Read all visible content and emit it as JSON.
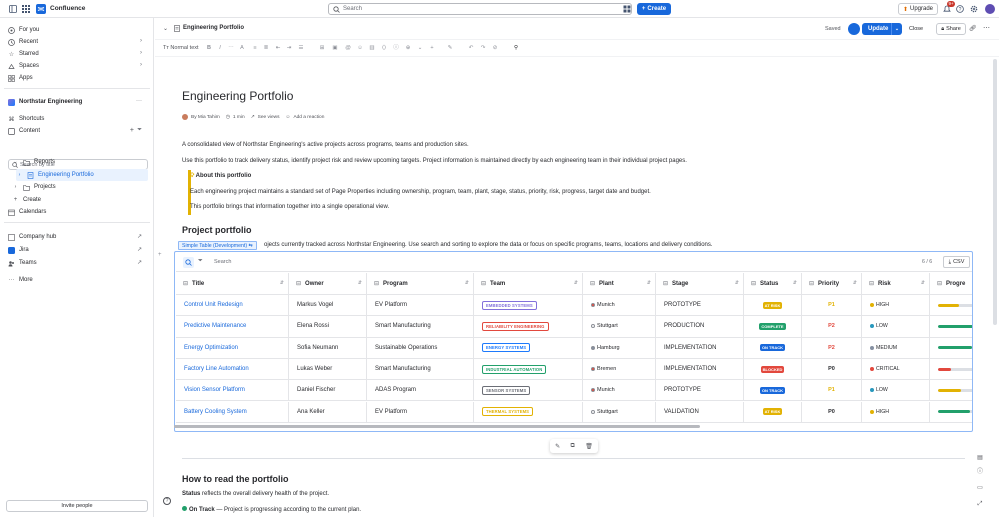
{
  "topbar": {
    "app_name": "Confluence",
    "search_placeholder": "Search",
    "create_label": "Create",
    "upgrade_label": "Upgrade",
    "notifications_count": "9+"
  },
  "sidebar": {
    "items_top": [
      {
        "label": "For you"
      },
      {
        "label": "Recent"
      },
      {
        "label": "Starred"
      },
      {
        "label": "Spaces"
      },
      {
        "label": "Apps"
      }
    ],
    "space_name": "Northstar Engineering",
    "shortcuts_label": "Shortcuts",
    "content_label": "Content",
    "search_placeholder": "Search by title",
    "tree": [
      {
        "label": "Reports"
      },
      {
        "label": "Engineering Portfolio"
      },
      {
        "label": "Projects"
      },
      {
        "label": "Create"
      }
    ],
    "calendars_label": "Calendars",
    "apps": [
      {
        "label": "Company hub"
      },
      {
        "label": "Jira"
      },
      {
        "label": "Teams"
      }
    ],
    "more_label": "More",
    "invite_label": "Invite people"
  },
  "page_header": {
    "title": "Engineering Portfolio",
    "saved_label": "Saved",
    "update_label": "Update",
    "close_label": "Close",
    "share_label": "Share"
  },
  "toolbar": {
    "text_style": "Normal text"
  },
  "doc": {
    "title": "Engineering Portfolio",
    "byline": {
      "author": "By Mia Tahim",
      "read_time": "1 min",
      "views": "See views",
      "reaction": "Add a reaction"
    },
    "intro1": "A consolidated view of Northstar Engineering's active projects across programs, teams and production sites.",
    "intro2": "Use this portfolio to track delivery status, identify project risk and review upcoming targets. Project information is maintained directly by each engineering team in their individual project pages.",
    "info_title": "About this portfolio",
    "info_p1": "Each engineering project maintains a standard set of Page Properties including ownership, program, team, plant, stage, status, priority, risk, progress, target date and budget.",
    "info_p2": "This portfolio brings that information together into a single operational view.",
    "section1": "Project portfolio",
    "section1_text": "ojects currently tracked across Northstar Engineering. Use search and sorting to explore the data or focus on specific programs, teams, locations and delivery conditions.",
    "table_tag": "Simple Table (Development)",
    "section2": "How to read the portfolio",
    "status_bold": "Status",
    "status_text": " reflects the overall delivery health of the project.",
    "ontrack_bold": "On Track",
    "ontrack_text": " — Project is progressing according to the current plan."
  },
  "table": {
    "search_placeholder": "Search",
    "count": "6 / 6",
    "csv_label": "CSV",
    "headers": [
      "Title",
      "Owner",
      "Program",
      "Team",
      "Plant",
      "Stage",
      "Status",
      "Priority",
      "Risk",
      "Progre"
    ],
    "rows": [
      {
        "title": "Control Unit Redesign",
        "owner": "Markus Vogel",
        "program": "EV Platform",
        "team": "EMBEDDED SYSTEMS",
        "team_color": "#8270db",
        "plant": "Munich",
        "plant_color": "#e2483d",
        "stage": "PROTOTYPE",
        "status": "AT RISK",
        "status_color": "#e2b203",
        "priority": "P1",
        "priority_color": "#e2b203",
        "risk": "HIGH",
        "risk_color": "#e2b203",
        "progress": 0.55,
        "progress_color": "#e2b203"
      },
      {
        "title": "Predictive Maintenance",
        "owner": "Elena Rossi",
        "program": "Smart Manufacturing",
        "team": "RELIABILITY ENGINEERING",
        "team_color": "#e2483d",
        "plant": "Stuttgart",
        "plant_color": "#ffffff",
        "stage": "PRODUCTION",
        "status": "COMPLETE",
        "status_color": "#22a06b",
        "priority": "P2",
        "priority_color": "#e2483d",
        "risk": "LOW",
        "risk_color": "#2898bd",
        "progress": 1.0,
        "progress_color": "#22a06b"
      },
      {
        "title": "Energy Optimization",
        "owner": "Sofia Neumann",
        "program": "Sustainable Operations",
        "team": "ENERGY SYSTEMS",
        "team_color": "#1d7afc",
        "plant": "Hamburg",
        "plant_color": "#8590a2",
        "stage": "IMPLEMENTATION",
        "status": "ON TRACK",
        "status_color": "#1868db",
        "priority": "P2",
        "priority_color": "#e2483d",
        "risk": "MEDIUM",
        "risk_color": "#8590a2",
        "progress": 0.9,
        "progress_color": "#22a06b"
      },
      {
        "title": "Factory Line Automation",
        "owner": "Lukas Weber",
        "program": "Smart Manufacturing",
        "team": "INDUSTRIAL AUTOMATION",
        "team_color": "#22a06b",
        "plant": "Bremen",
        "plant_color": "#e2483d",
        "stage": "IMPLEMENTATION",
        "status": "BLOCKED",
        "status_color": "#e2483d",
        "priority": "P0",
        "priority_color": "#292a2e",
        "risk": "CRITICAL",
        "risk_color": "#e2483d",
        "progress": 0.35,
        "progress_color": "#e2483d"
      },
      {
        "title": "Vision Sensor Platform",
        "owner": "Daniel Fischer",
        "program": "ADAS Program",
        "team": "SENSOR SYSTEMS",
        "team_color": "#6b6e76",
        "plant": "Munich",
        "plant_color": "#e2483d",
        "stage": "PROTOTYPE",
        "status": "ON TRACK",
        "status_color": "#1868db",
        "priority": "P1",
        "priority_color": "#e2b203",
        "risk": "LOW",
        "risk_color": "#2898bd",
        "progress": 0.6,
        "progress_color": "#e2b203"
      },
      {
        "title": "Battery Cooling System",
        "owner": "Ana Keller",
        "program": "EV Platform",
        "team": "THERMAL SYSTEMS",
        "team_color": "#e2b203",
        "plant": "Stuttgart",
        "plant_color": "#ffffff",
        "stage": "VALIDATION",
        "status": "AT RISK",
        "status_color": "#e2b203",
        "priority": "P0",
        "priority_color": "#292a2e",
        "risk": "HIGH",
        "risk_color": "#e2b203",
        "progress": 0.85,
        "progress_color": "#22a06b"
      }
    ]
  }
}
